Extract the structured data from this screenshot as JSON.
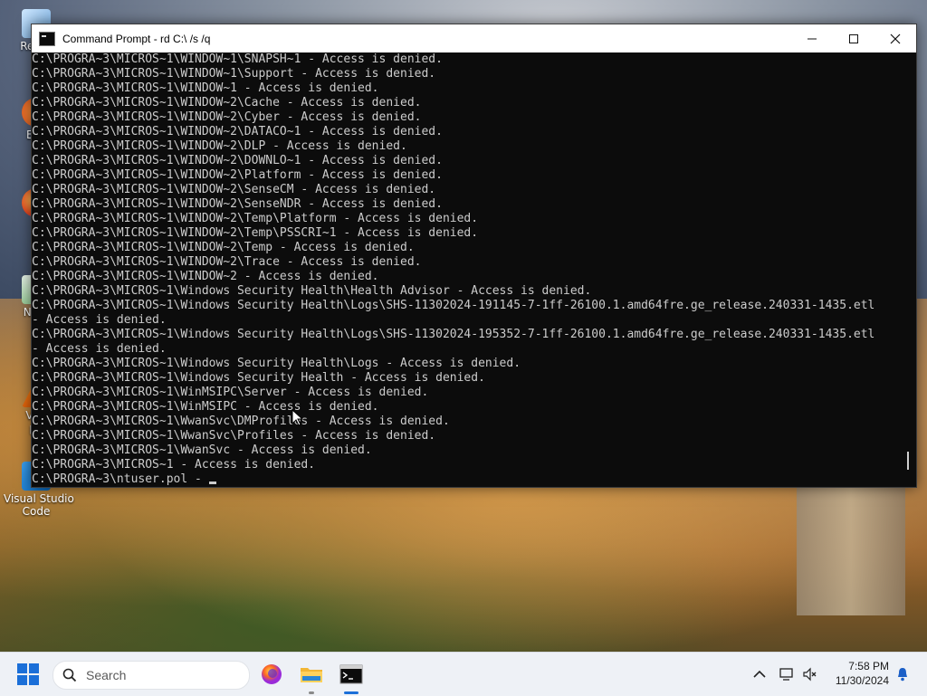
{
  "window": {
    "title": "Command Prompt - rd  C:\\ /s /q",
    "controls": {
      "minimize": "—",
      "maximize": "☐",
      "close": "✕"
    }
  },
  "console": {
    "lines": [
      "C:\\PROGRA~3\\MICROS~1\\WINDOW~1\\SNAPSH~1 - Access is denied.",
      "C:\\PROGRA~3\\MICROS~1\\WINDOW~1\\Support - Access is denied.",
      "C:\\PROGRA~3\\MICROS~1\\WINDOW~1 - Access is denied.",
      "C:\\PROGRA~3\\MICROS~1\\WINDOW~2\\Cache - Access is denied.",
      "C:\\PROGRA~3\\MICROS~1\\WINDOW~2\\Cyber - Access is denied.",
      "C:\\PROGRA~3\\MICROS~1\\WINDOW~2\\DATACO~1 - Access is denied.",
      "C:\\PROGRA~3\\MICROS~1\\WINDOW~2\\DLP - Access is denied.",
      "C:\\PROGRA~3\\MICROS~1\\WINDOW~2\\DOWNLO~1 - Access is denied.",
      "C:\\PROGRA~3\\MICROS~1\\WINDOW~2\\Platform - Access is denied.",
      "C:\\PROGRA~3\\MICROS~1\\WINDOW~2\\SenseCM - Access is denied.",
      "C:\\PROGRA~3\\MICROS~1\\WINDOW~2\\SenseNDR - Access is denied.",
      "C:\\PROGRA~3\\MICROS~1\\WINDOW~2\\Temp\\Platform - Access is denied.",
      "C:\\PROGRA~3\\MICROS~1\\WINDOW~2\\Temp\\PSSCRI~1 - Access is denied.",
      "C:\\PROGRA~3\\MICROS~1\\WINDOW~2\\Temp - Access is denied.",
      "C:\\PROGRA~3\\MICROS~1\\WINDOW~2\\Trace - Access is denied.",
      "C:\\PROGRA~3\\MICROS~1\\WINDOW~2 - Access is denied.",
      "C:\\PROGRA~3\\MICROS~1\\Windows Security Health\\Health Advisor - Access is denied.",
      "C:\\PROGRA~3\\MICROS~1\\Windows Security Health\\Logs\\SHS-11302024-191145-7-1ff-26100.1.amd64fre.ge_release.240331-1435.etl",
      "- Access is denied.",
      "C:\\PROGRA~3\\MICROS~1\\Windows Security Health\\Logs\\SHS-11302024-195352-7-1ff-26100.1.amd64fre.ge_release.240331-1435.etl",
      "- Access is denied.",
      "C:\\PROGRA~3\\MICROS~1\\Windows Security Health\\Logs - Access is denied.",
      "C:\\PROGRA~3\\MICROS~1\\Windows Security Health - Access is denied.",
      "C:\\PROGRA~3\\MICROS~1\\WinMSIPC\\Server - Access is denied.",
      "C:\\PROGRA~3\\MICROS~1\\WinMSIPC - Access is denied.",
      "C:\\PROGRA~3\\MICROS~1\\WwanSvc\\DMProfiles - Access is denied.",
      "C:\\PROGRA~3\\MICROS~1\\WwanSvc\\Profiles - Access is denied.",
      "C:\\PROGRA~3\\MICROS~1\\WwanSvc - Access is denied.",
      "C:\\PROGRA~3\\MICROS~1 - Access is denied.",
      "C:\\PROGRA~3\\ntuser.pol - "
    ]
  },
  "desktop_icons": [
    {
      "label": "Recyc",
      "icon": "recycle-bin-icon"
    },
    {
      "label": "Eve",
      "icon": "everything-icon"
    },
    {
      "label": "Fi",
      "icon": "firefox-icon"
    },
    {
      "label": "Note",
      "icon": "notepad-icon"
    },
    {
      "label": "VLC\nph",
      "icon": "vlc-icon"
    },
    {
      "label": "Visual Studio\nCode",
      "icon": "vscode-icon"
    }
  ],
  "taskbar": {
    "search_placeholder": "Search",
    "apps": [
      {
        "name": "firefox",
        "icon": "firefox-icon"
      },
      {
        "name": "file-explorer",
        "icon": "folder-icon"
      },
      {
        "name": "terminal",
        "icon": "terminal-icon"
      }
    ],
    "clock_time": "7:58 PM",
    "clock_date": "11/30/2024"
  },
  "colors": {
    "console_bg": "#0c0c0c",
    "console_fg": "#cccccc",
    "accent": "#1b6fd8"
  }
}
